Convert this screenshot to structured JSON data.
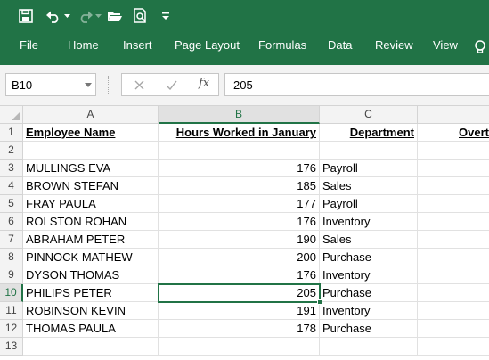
{
  "quick_access": {
    "icons": [
      "save-icon",
      "undo-icon",
      "redo-icon",
      "open-folder-icon",
      "print-preview-icon",
      "customize-qat-icon"
    ]
  },
  "ribbon": {
    "tabs": [
      "File",
      "Home",
      "Insert",
      "Page Layout",
      "Formulas",
      "Data",
      "Review",
      "View"
    ],
    "tell_me_icon": "lightbulb-icon"
  },
  "formula_bar": {
    "name_box": "B10",
    "formula_value": "205",
    "fx_label": "fx"
  },
  "sheet": {
    "columns": [
      "A",
      "B",
      "C"
    ],
    "rows": [
      "1",
      "2",
      "3",
      "4",
      "5",
      "6",
      "7",
      "8",
      "9",
      "10",
      "11",
      "12",
      "13"
    ],
    "headers": {
      "a": "Employee Name",
      "b": "Hours Worked in January",
      "c": "Department",
      "d": "Overt"
    },
    "data": [
      {
        "name": "MULLINGS EVA",
        "hours": "176",
        "dept": "Payroll"
      },
      {
        "name": "BROWN STEFAN",
        "hours": "185",
        "dept": "Sales"
      },
      {
        "name": "FRAY PAULA",
        "hours": "177",
        "dept": "Payroll"
      },
      {
        "name": "ROLSTON ROHAN",
        "hours": "176",
        "dept": "Inventory"
      },
      {
        "name": "ABRAHAM PETER",
        "hours": "190",
        "dept": "Sales"
      },
      {
        "name": "PINNOCK MATHEW",
        "hours": "200",
        "dept": "Purchase"
      },
      {
        "name": "DYSON THOMAS",
        "hours": "176",
        "dept": "Inventory"
      },
      {
        "name": "PHILIPS PETER",
        "hours": "205",
        "dept": "Purchase"
      },
      {
        "name": "ROBINSON KEVIN",
        "hours": "191",
        "dept": "Inventory"
      },
      {
        "name": "THOMAS PAULA",
        "hours": "178",
        "dept": "Purchase"
      }
    ],
    "active_cell": "B10"
  },
  "colors": {
    "accent": "#217346",
    "header_bg": "#f3f3f3"
  }
}
